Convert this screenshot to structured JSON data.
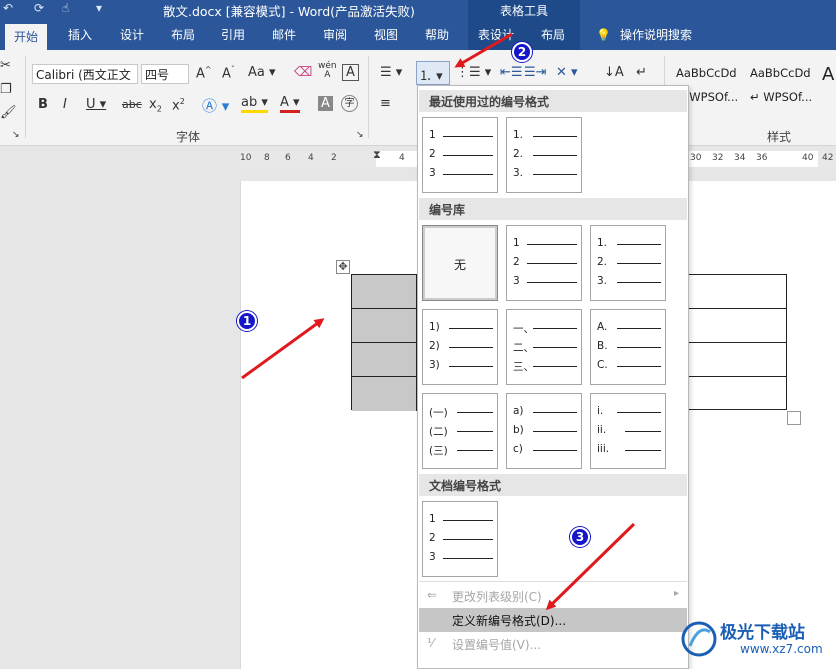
{
  "titlebar": {
    "document_title": "散文.docx [兼容模式] - Word(产品激活失败)",
    "context_group": "表格工具"
  },
  "tabs": [
    "开始",
    "插入",
    "设计",
    "布局",
    "引用",
    "邮件",
    "审阅",
    "视图",
    "帮助",
    "表设计",
    "布局"
  ],
  "tell_me": "操作说明搜索",
  "ribbon": {
    "font_name": "Calibri (西文正文",
    "font_size": "四号",
    "font_group_label": "字体",
    "styles_group_label": "样式",
    "style_previews": [
      "AaBbCcDd",
      "AaBbCcDd",
      "A"
    ],
    "style_names": [
      "WPSOf...",
      "WPSOf..."
    ],
    "phonetic_label": "wén"
  },
  "ruler": {
    "left_ticks": [
      "10",
      "8",
      "6",
      "4",
      "2"
    ],
    "mid_tick": "4",
    "right_ticks": [
      "30",
      "32",
      "34",
      "36",
      "40",
      "42"
    ]
  },
  "dropdown": {
    "recent_header": "最近使用过的编号格式",
    "library_header": "编号库",
    "document_header": "文档编号格式",
    "none_label": "无",
    "recent_formats": [
      [
        "1",
        "2",
        "3"
      ],
      [
        "1.",
        "2.",
        "3."
      ]
    ],
    "library_formats": [
      [
        "1",
        "2",
        "3"
      ],
      [
        "1.",
        "2.",
        "3."
      ],
      [
        "1)",
        "2)",
        "3)"
      ],
      [
        "一、",
        "二、",
        "三、"
      ],
      [
        "A.",
        "B.",
        "C."
      ],
      [
        "(一)",
        "(二)",
        "(三)"
      ],
      [
        "a)",
        "b)",
        "c)"
      ],
      [
        "i.",
        "ii.",
        "iii."
      ]
    ],
    "document_formats": [
      [
        "1",
        "2",
        "3"
      ]
    ],
    "menu": {
      "change_level": "更改列表级别(C)",
      "define_new": "定义新编号格式(D)...",
      "set_value": "设置编号值(V)..."
    }
  },
  "annotations": {
    "badges": [
      "1",
      "2",
      "3"
    ],
    "accent_color": "#e0191c",
    "badge_color": "#1515c9"
  },
  "watermark": {
    "title": "极光下载站",
    "url": "www.xz7.com"
  },
  "colors": {
    "ribbon_blue": "#2b579a",
    "highlight": "#ffd800",
    "font_red": "#d32020"
  }
}
